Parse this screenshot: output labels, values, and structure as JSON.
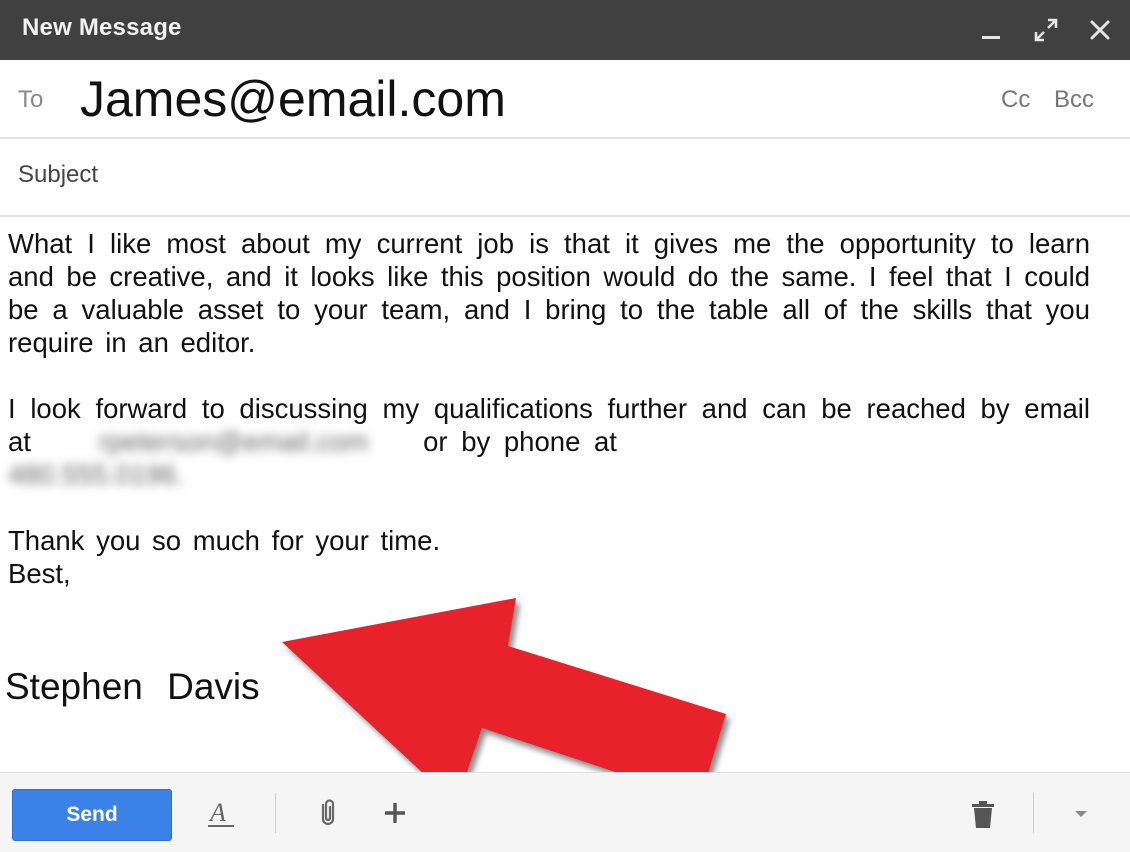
{
  "window": {
    "title": "New Message"
  },
  "to": {
    "label": "To",
    "value": "James@email.com",
    "cc_label": "Cc",
    "bcc_label": "Bcc"
  },
  "subject": {
    "placeholder": "Subject",
    "value": ""
  },
  "body": {
    "paragraph1": "What I like most about my current job is that it gives me the opportunity to learn and be creative, and it looks like this position would do the same. I feel that I could be a valuable asset to your team, and I bring to the table all of the skills that you require in an editor.",
    "paragraph2_before_email": "I look forward to discussing my qualifications further and can be reached by email at",
    "redacted_email": "rpeterson@email.com",
    "paragraph2_between": "or by phone at",
    "redacted_phone": "480.555.0196.",
    "closing_line1": "Thank you so much for your time.",
    "closing_line2": "Best,",
    "signature": "Stephen Davis"
  },
  "toolbar": {
    "send_label": "Send"
  },
  "colors": {
    "titlebar": "#404040",
    "send_button": "#3b82e8",
    "arrow": "#e8202a",
    "toolbar_bg": "#f5f5f5"
  },
  "icons": {
    "minimize": "minimize-icon",
    "expand": "expand-icon",
    "close": "close-icon",
    "formatting": "text-format-icon",
    "attach": "paperclip-icon",
    "more": "plus-icon",
    "discard": "trash-icon",
    "options": "chevron-down-icon"
  }
}
